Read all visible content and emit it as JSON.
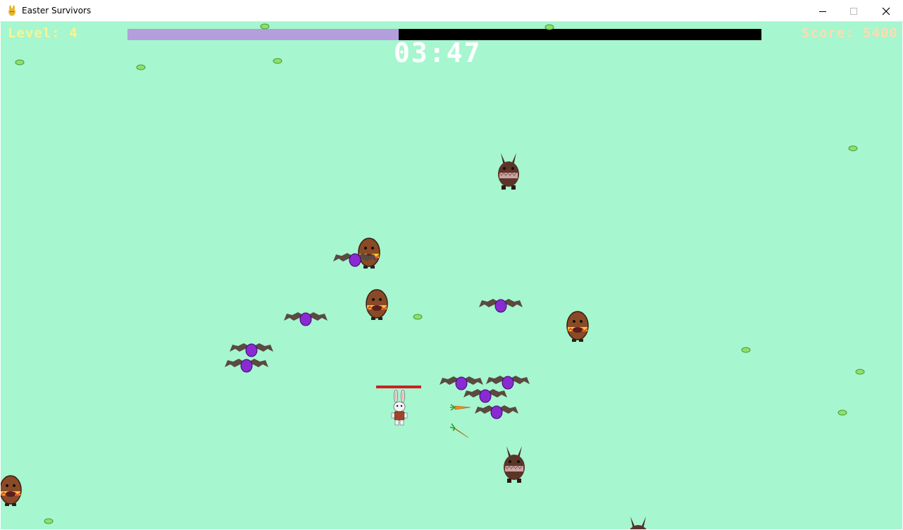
{
  "window": {
    "title": "Easter Survivors",
    "controls": [
      "minimize-icon",
      "maximize-icon",
      "close-icon"
    ]
  },
  "hud": {
    "level_text": "Level: 4",
    "score_text": "Score: 5400",
    "timer": "03:47",
    "xp_fraction": 0.428
  },
  "colors": {
    "background": "#a6f6cf",
    "level_text": "#f5f594",
    "score_text": "#fcdcb0",
    "xp_fill": "#b49edc",
    "xp_track": "#000000",
    "player_health": "#d21e1e"
  },
  "entities": {
    "player": "bunny-player",
    "enemies": [
      "chocolate-egg-enemy",
      "bat-egg-enemy",
      "chocolate-bunny-enemy"
    ],
    "projectiles": [
      "carrot-projectile"
    ],
    "pickups": [
      "green-xp-gem"
    ]
  }
}
